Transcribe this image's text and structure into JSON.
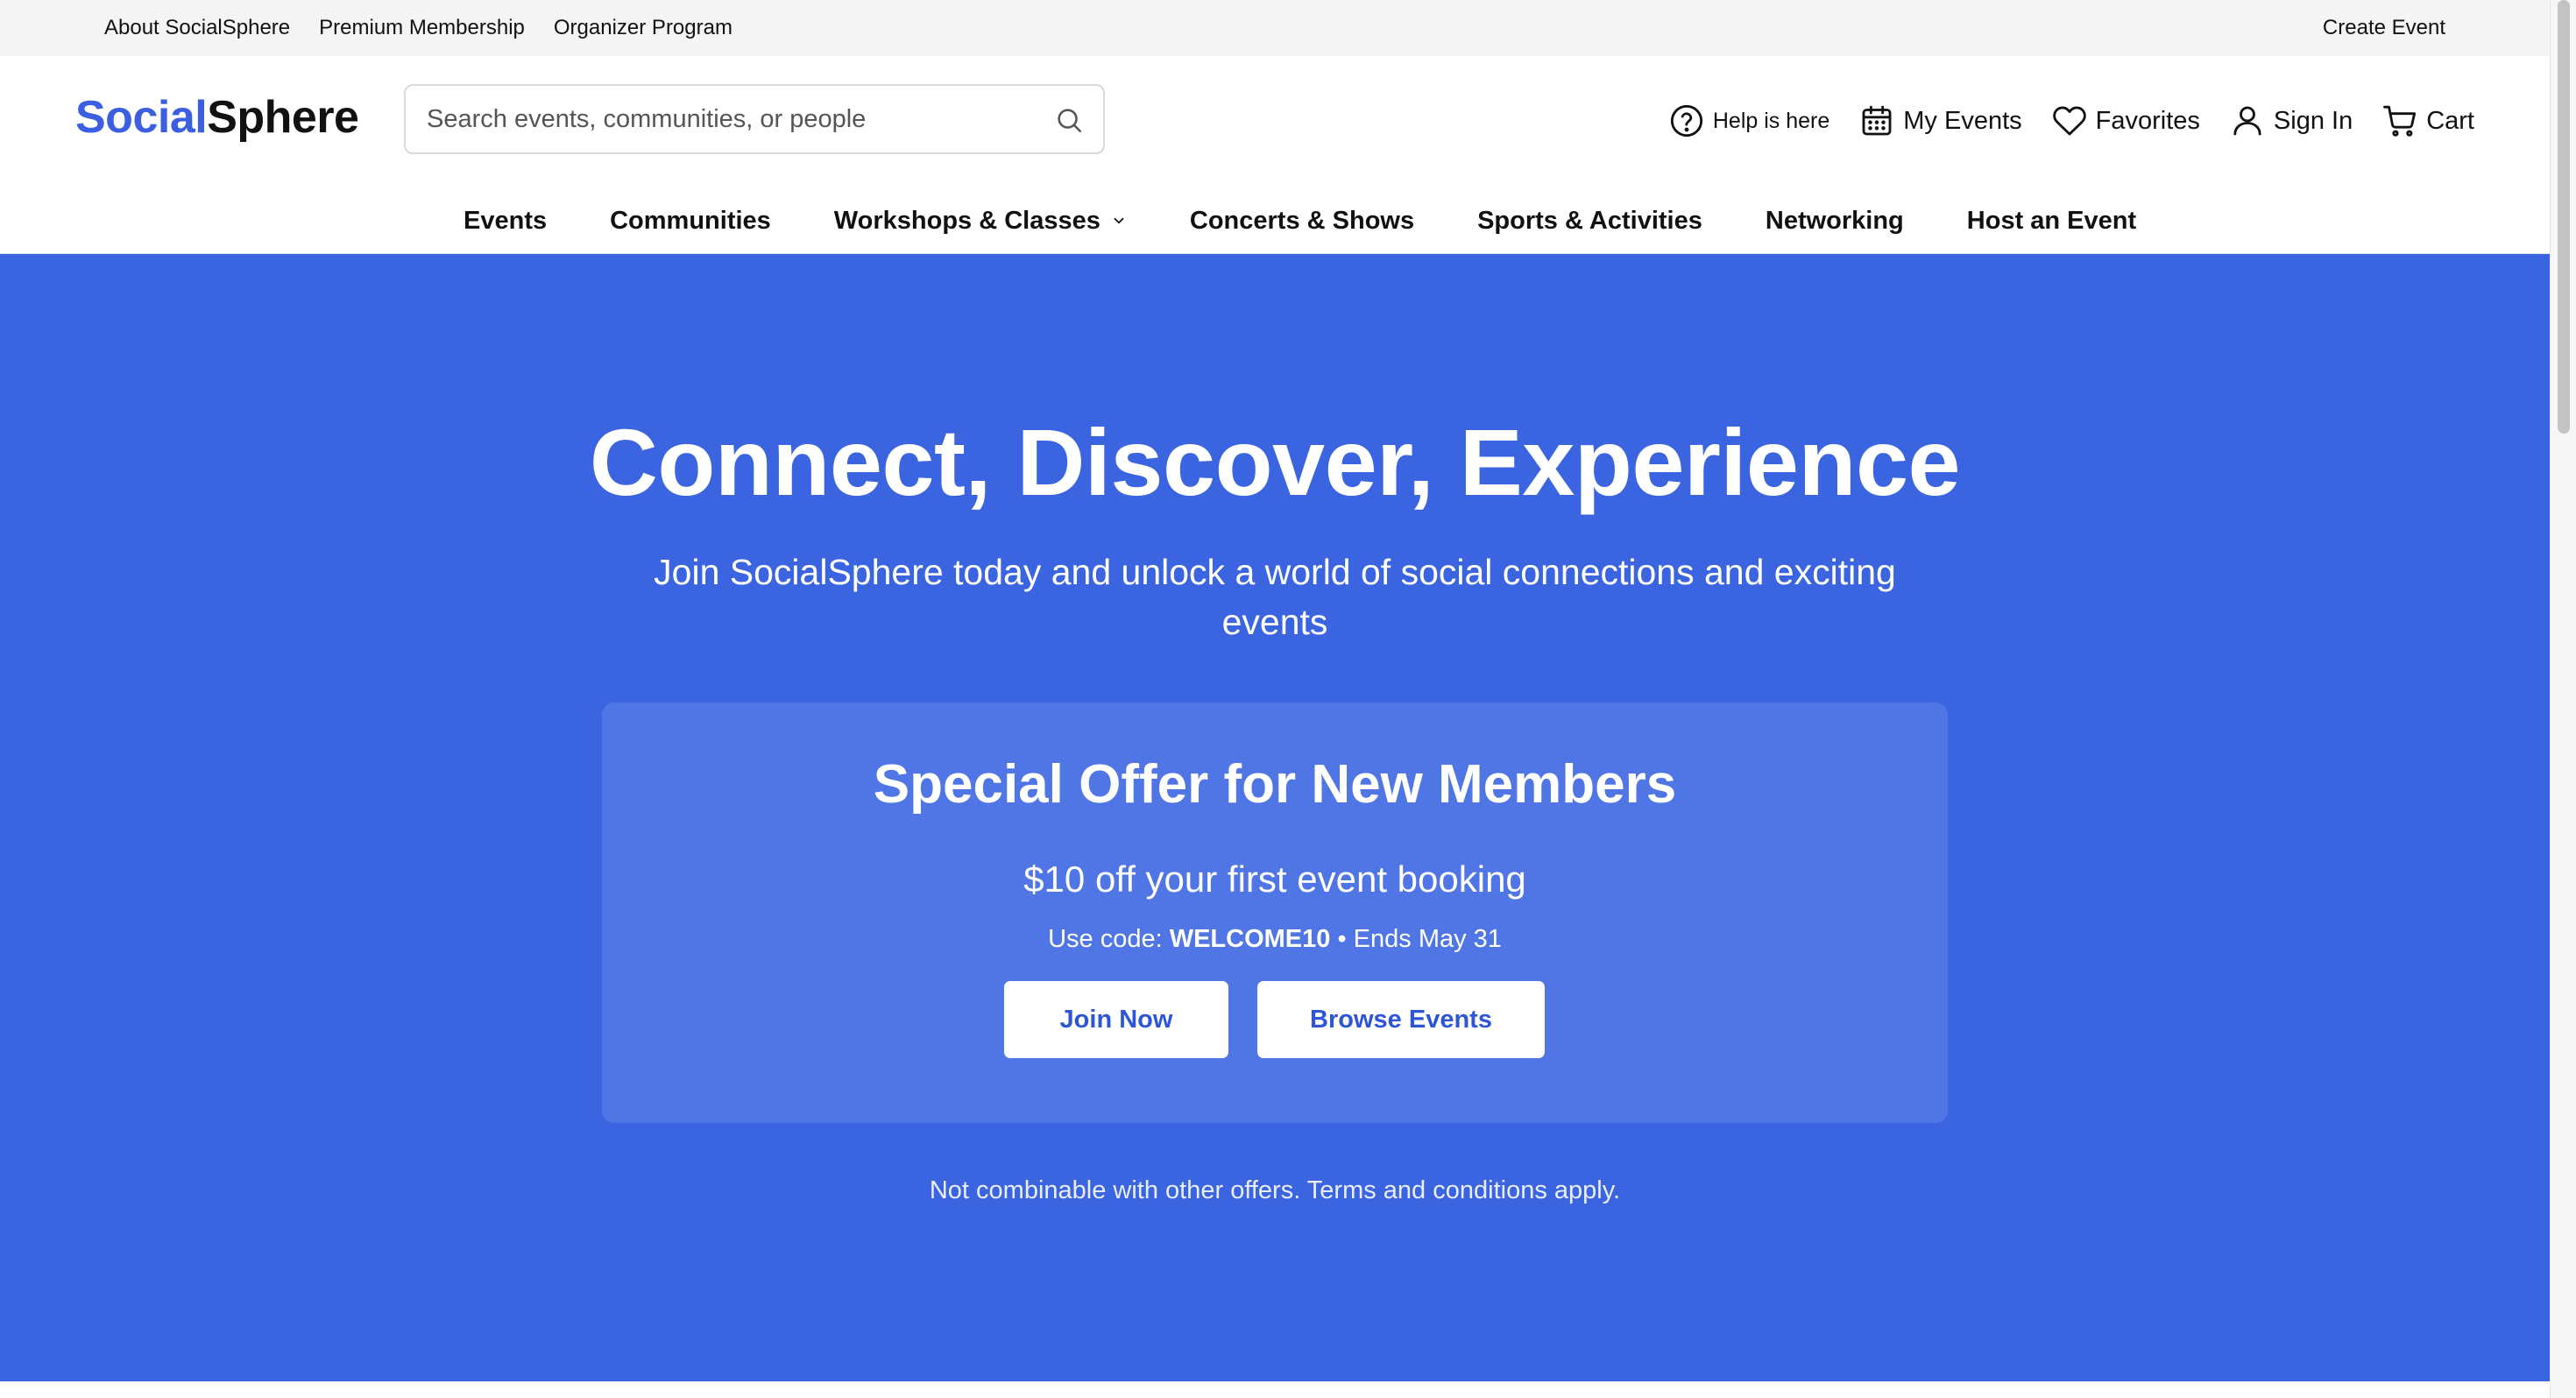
{
  "topbar": {
    "links": [
      "About SocialSphere",
      "Premium Membership",
      "Organizer Program"
    ],
    "create_event": "Create Event"
  },
  "header": {
    "logo_part1": "Social",
    "logo_part2": "Sphere",
    "search_placeholder": "Search events, communities, or people",
    "utilities": {
      "help": "Help is here",
      "my_events": "My Events",
      "favorites": "Favorites",
      "sign_in": "Sign In",
      "cart": "Cart"
    },
    "nav": [
      "Events",
      "Communities",
      "Workshops & Classes",
      "Concerts & Shows",
      "Sports & Activities",
      "Networking",
      "Host an Event"
    ]
  },
  "hero": {
    "title": "Connect, Discover, Experience",
    "subtitle": "Join SocialSphere today and unlock a world of social connections and exciting events",
    "offer": {
      "title": "Special Offer for New Members",
      "amount": "$10 off your first event booking",
      "code_prefix": "Use code: ",
      "code": "WELCOME10",
      "code_suffix": " • Ends May 31",
      "join_label": "Join Now",
      "browse_label": "Browse Events"
    },
    "terms": "Not combinable with other offers. Terms and conditions apply."
  },
  "colors": {
    "brand": "#3b5fe0",
    "hero_bg": "#3b64e1",
    "button_text": "#2d55d6"
  }
}
